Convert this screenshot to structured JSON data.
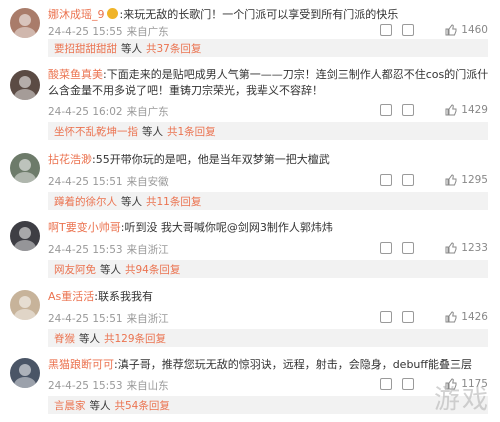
{
  "comments": [
    {
      "username": "娜沐成瑶_9",
      "text": ":来玩无敌的长歌门！一个门派可以享受到所有门派的快乐",
      "date": "24-4-25 15:55",
      "location": "来自广东",
      "likes": "1460",
      "reply_user": "要招甜甜甜甜",
      "reply_others": "等人",
      "reply_count": "共37条回复"
    },
    {
      "username": "酸菜鱼真美",
      "text": ":下面走来的是贴吧成男人气第一——刀宗！连剑三制作人都忍不住cos的门派什么含金量不用多说了吧！重铸刀宗荣光，我辈义不容辞！",
      "date": "24-4-25 16:02",
      "location": "来自广东",
      "likes": "1429",
      "reply_user": "坐怀不乱乾坤一指",
      "reply_others": "等人",
      "reply_count": "共1条回复"
    },
    {
      "username": "拈花浩渺",
      "text": ":55开带你玩的是吧，他是当年双梦第一把大檀武",
      "date": "24-4-25 15:51",
      "location": "来自安徽",
      "likes": "1295",
      "reply_user": "蹲着的徐尔人",
      "reply_others": "等人",
      "reply_count": "共11条回复"
    },
    {
      "username": "啊T要变小帅哥",
      "text": ":听到没 我大哥喊你呢@剑网3制作人郭炜炜",
      "date": "24-4-25 15:53",
      "location": "来自浙江",
      "likes": "1233",
      "reply_user": "网友阿免",
      "reply_others": "等人",
      "reply_count": "共94条回复"
    },
    {
      "username": "As重活活",
      "text": ":联系我我有",
      "date": "24-4-25 15:51",
      "location": "来自浙江",
      "likes": "1426",
      "reply_user": "脊猴",
      "reply_others": "等人",
      "reply_count": "共129条回复"
    },
    {
      "username": "黑猫踉断可可",
      "text": ":滇子哥，推荐您玩无敌的惊羽诀，远程，射击，会隐身，debuff能叠三层",
      "date": "24-4-25 15:53",
      "location": "来自山东",
      "likes": "1175",
      "reply_user": "言晨家",
      "reply_others": "等人",
      "reply_count": "共54条回复"
    }
  ],
  "watermark": "游戏"
}
